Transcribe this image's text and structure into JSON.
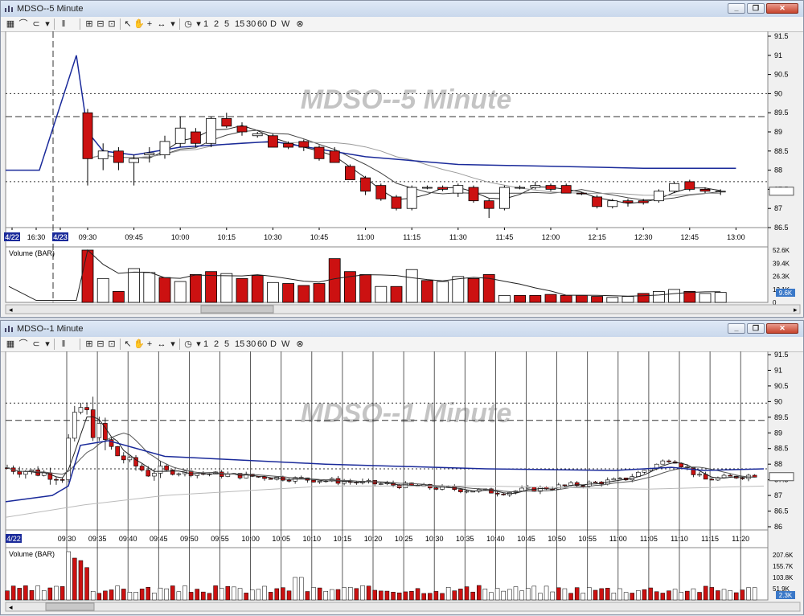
{
  "windows": [
    {
      "title": "MDSO--5 Minute",
      "watermark": "MDSO--5 Minute",
      "volume_label": "Volume (BAR)",
      "toolbar": {
        "icon_names": [
          "chart-bars-icon",
          "line-chart-icon",
          "link-icon",
          "pan-icon",
          "zoom-in-icon",
          "zoom-out-icon",
          "fit-icon",
          "pointer-icon",
          "hand-icon",
          "crosshair-icon",
          "measure-icon",
          "clock-icon"
        ],
        "periods": [
          "1",
          "2",
          "5",
          "15",
          "30",
          "60",
          "D",
          "W"
        ]
      },
      "window_buttons": [
        "minimize",
        "restore",
        "close"
      ]
    },
    {
      "title": "MDSO--1 Minute",
      "watermark": "MDSO--1 Minute",
      "volume_label": "Volume (BAR)",
      "toolbar": {
        "icon_names": [
          "chart-bars-icon",
          "line-chart-icon",
          "link-icon",
          "pan-icon",
          "zoom-in-icon",
          "zoom-out-icon",
          "fit-icon",
          "pointer-icon",
          "hand-icon",
          "crosshair-icon",
          "measure-icon",
          "clock-icon"
        ],
        "periods": [
          "1",
          "2",
          "5",
          "15",
          "30",
          "60",
          "D",
          "W"
        ]
      },
      "window_buttons": [
        "minimize",
        "restore",
        "close"
      ]
    }
  ],
  "colors": {
    "down": "#cc1111",
    "up": "#ffffff",
    "blue": "#1a2a9a",
    "grid": "#000000",
    "watermark": "#c4c4c4"
  },
  "chart_data": [
    {
      "type": "candlestick",
      "title": "MDSO--5 Minute",
      "x_ticks": [
        "4/22",
        "16:30",
        "4/23",
        "09:30",
        "09:45",
        "10:00",
        "10:15",
        "10:30",
        "10:45",
        "11:00",
        "11:15",
        "11:30",
        "11:45",
        "12:00",
        "12:15",
        "12:30",
        "12:45",
        "13:00"
      ],
      "y_ticks": [
        "86.5",
        "87",
        "87.5",
        "88",
        "88.5",
        "89",
        "89.5",
        "90",
        "90.5",
        "91",
        "91.5"
      ],
      "ylim": [
        86.5,
        91.5
      ],
      "price_markers": [
        90.0,
        89.4,
        87.7
      ],
      "last_price": 87.45,
      "candles": [
        {
          "t": "09:30",
          "o": 89.5,
          "h": 89.6,
          "l": 87.6,
          "c": 88.3
        },
        {
          "t": "09:35",
          "o": 88.3,
          "h": 88.7,
          "l": 88.0,
          "c": 88.5
        },
        {
          "t": "09:40",
          "o": 88.5,
          "h": 88.6,
          "l": 88.0,
          "c": 88.2
        },
        {
          "t": "09:45",
          "o": 88.2,
          "h": 88.4,
          "l": 87.6,
          "c": 88.3
        },
        {
          "t": "09:50",
          "o": 88.4,
          "h": 88.6,
          "l": 88.2,
          "c": 88.45
        },
        {
          "t": "09:55",
          "o": 88.4,
          "h": 88.9,
          "l": 88.3,
          "c": 88.75
        },
        {
          "t": "10:00",
          "o": 88.7,
          "h": 89.4,
          "l": 88.6,
          "c": 89.1
        },
        {
          "t": "10:05",
          "o": 89.0,
          "h": 89.1,
          "l": 88.6,
          "c": 88.7
        },
        {
          "t": "10:10",
          "o": 88.7,
          "h": 89.4,
          "l": 88.6,
          "c": 89.35
        },
        {
          "t": "10:15",
          "o": 89.35,
          "h": 89.5,
          "l": 89.1,
          "c": 89.15
        },
        {
          "t": "10:20",
          "o": 89.15,
          "h": 89.25,
          "l": 88.9,
          "c": 89.0
        },
        {
          "t": "10:25",
          "o": 88.9,
          "h": 89.0,
          "l": 88.85,
          "c": 88.95
        },
        {
          "t": "10:30",
          "o": 88.9,
          "h": 88.95,
          "l": 88.6,
          "c": 88.6
        },
        {
          "t": "10:35",
          "o": 88.7,
          "h": 88.75,
          "l": 88.55,
          "c": 88.6
        },
        {
          "t": "10:40",
          "o": 88.75,
          "h": 88.8,
          "l": 88.5,
          "c": 88.6
        },
        {
          "t": "10:45",
          "o": 88.6,
          "h": 88.65,
          "l": 88.25,
          "c": 88.3
        },
        {
          "t": "10:50",
          "o": 88.5,
          "h": 88.6,
          "l": 88.2,
          "c": 88.2
        },
        {
          "t": "10:55",
          "o": 88.1,
          "h": 88.15,
          "l": 87.75,
          "c": 87.75
        },
        {
          "t": "11:00",
          "o": 87.8,
          "h": 87.85,
          "l": 87.35,
          "c": 87.45
        },
        {
          "t": "11:05",
          "o": 87.6,
          "h": 87.65,
          "l": 87.2,
          "c": 87.25
        },
        {
          "t": "11:10",
          "o": 87.3,
          "h": 87.35,
          "l": 86.95,
          "c": 87.0
        },
        {
          "t": "11:15",
          "o": 87.0,
          "h": 87.6,
          "l": 86.95,
          "c": 87.55
        },
        {
          "t": "11:20",
          "o": 87.55,
          "h": 87.6,
          "l": 87.5,
          "c": 87.55
        },
        {
          "t": "11:25",
          "o": 87.55,
          "h": 87.6,
          "l": 87.45,
          "c": 87.5
        },
        {
          "t": "11:30",
          "o": 87.4,
          "h": 87.65,
          "l": 87.3,
          "c": 87.6
        },
        {
          "t": "11:35",
          "o": 87.55,
          "h": 87.6,
          "l": 87.15,
          "c": 87.2
        },
        {
          "t": "11:40",
          "o": 87.2,
          "h": 87.25,
          "l": 86.75,
          "c": 87.0
        },
        {
          "t": "11:45",
          "o": 87.0,
          "h": 87.6,
          "l": 86.95,
          "c": 87.55
        },
        {
          "t": "11:50",
          "o": 87.55,
          "h": 87.6,
          "l": 87.5,
          "c": 87.55
        },
        {
          "t": "11:55",
          "o": 87.55,
          "h": 87.7,
          "l": 87.5,
          "c": 87.6
        },
        {
          "t": "12:00",
          "o": 87.6,
          "h": 87.65,
          "l": 87.45,
          "c": 87.5
        },
        {
          "t": "12:05",
          "o": 87.6,
          "h": 87.65,
          "l": 87.4,
          "c": 87.4
        },
        {
          "t": "12:10",
          "o": 87.4,
          "h": 87.42,
          "l": 87.35,
          "c": 87.38
        },
        {
          "t": "12:15",
          "o": 87.3,
          "h": 87.35,
          "l": 87.0,
          "c": 87.05
        },
        {
          "t": "12:20",
          "o": 87.05,
          "h": 87.25,
          "l": 87.0,
          "c": 87.2
        },
        {
          "t": "12:25",
          "o": 87.2,
          "h": 87.25,
          "l": 87.05,
          "c": 87.15
        },
        {
          "t": "12:30",
          "o": 87.2,
          "h": 87.25,
          "l": 87.1,
          "c": 87.15
        },
        {
          "t": "12:35",
          "o": 87.2,
          "h": 87.5,
          "l": 87.15,
          "c": 87.45
        },
        {
          "t": "12:40",
          "o": 87.45,
          "h": 87.7,
          "l": 87.4,
          "c": 87.65
        },
        {
          "t": "12:45",
          "o": 87.7,
          "h": 87.75,
          "l": 87.45,
          "c": 87.5
        },
        {
          "t": "12:50",
          "o": 87.5,
          "h": 87.55,
          "l": 87.4,
          "c": 87.45
        },
        {
          "t": "12:55",
          "o": 87.45,
          "h": 87.5,
          "l": 87.35,
          "c": 87.45
        }
      ],
      "vwap_line": {
        "name": "",
        "x": [
          "16:30",
          "09:25",
          "09:30",
          "09:35",
          "09:45",
          "10:00",
          "10:30",
          "11:00",
          "11:15",
          "11:30",
          "12:00",
          "12:30",
          "12:45",
          "13:00"
        ],
        "y": [
          88.0,
          91.0,
          89.0,
          88.5,
          88.4,
          88.6,
          88.75,
          88.35,
          88.25,
          88.15,
          88.1,
          88.05,
          88.05,
          88.05
        ]
      },
      "volume": {
        "y_ticks": [
          "0",
          "13.1K",
          "26.3K",
          "39.4K",
          "52.6K"
        ],
        "last": "9.6K",
        "values": [
          52600,
          24000,
          11000,
          34000,
          30000,
          25000,
          21000,
          28000,
          31000,
          29000,
          24000,
          27000,
          20000,
          19000,
          17000,
          19000,
          44000,
          31000,
          28000,
          16000,
          16000,
          33000,
          22000,
          21000,
          26000,
          24000,
          28000,
          7000,
          7000,
          7000,
          8000,
          7000,
          7000,
          6000,
          5000,
          6000,
          9000,
          11000,
          13000,
          11000,
          9000,
          10000
        ],
        "down": [
          true,
          false,
          true,
          false,
          false,
          true,
          false,
          true,
          true,
          false,
          true,
          true,
          false,
          true,
          true,
          true,
          true,
          true,
          true,
          false,
          true,
          false,
          true,
          false,
          false,
          true,
          true,
          false,
          true,
          true,
          true,
          true,
          true,
          true,
          false,
          false,
          true,
          false,
          false,
          true,
          false,
          false
        ]
      }
    },
    {
      "type": "candlestick",
      "title": "MDSO--1 Minute",
      "x_ticks": [
        "4/22",
        "09:30",
        "09:35",
        "09:40",
        "09:45",
        "09:50",
        "09:55",
        "10:00",
        "10:05",
        "10:10",
        "10:15",
        "10:20",
        "10:25",
        "10:30",
        "10:35",
        "10:40",
        "10:45",
        "10:50",
        "10:55",
        "11:00",
        "11:05",
        "11:10",
        "11:15",
        "11:20"
      ],
      "y_ticks": [
        "86",
        "86.5",
        "87",
        "87.5",
        "88",
        "88.5",
        "89",
        "89.5",
        "90",
        "90.5",
        "91",
        "91.5"
      ],
      "ylim": [
        86,
        91.5
      ],
      "price_markers": [
        89.95,
        89.4,
        87.85
      ],
      "last_price": 87.6,
      "volume": {
        "y_ticks": [
          "51.9K",
          "103.8K",
          "155.7K",
          "207.6K"
        ],
        "last": "2.3K"
      }
    }
  ]
}
